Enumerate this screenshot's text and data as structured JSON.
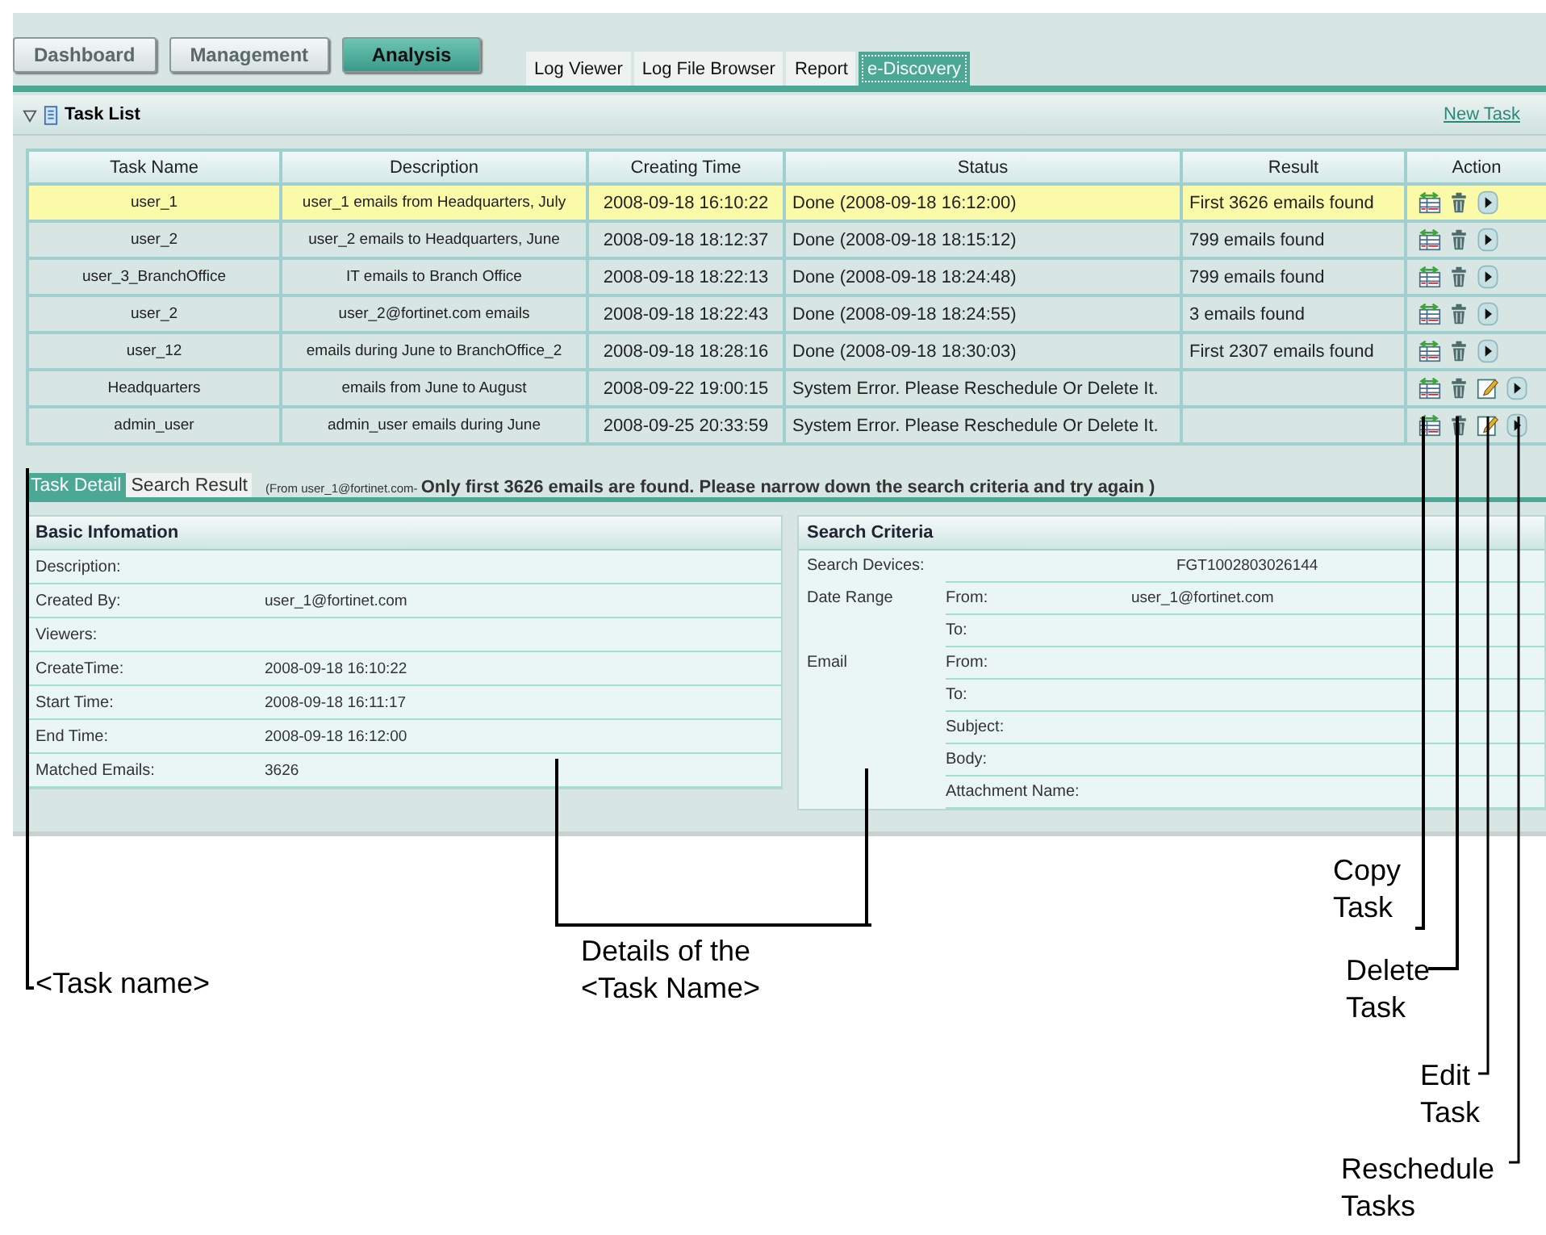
{
  "nav_buttons": [
    {
      "label": "Dashboard",
      "selected": false
    },
    {
      "label": "Management",
      "selected": false
    },
    {
      "label": "Analysis",
      "selected": true
    }
  ],
  "sub_tabs": [
    {
      "label": "Log Viewer",
      "selected": false
    },
    {
      "label": "Log File Browser",
      "selected": false
    },
    {
      "label": "Report",
      "selected": false
    },
    {
      "label": "e-Discovery",
      "selected": true
    }
  ],
  "task_list": {
    "title": "Task List",
    "expanded": true,
    "new_task_link": "New Task",
    "columns": [
      "Task Name",
      "Description",
      "Creating Time",
      "Status",
      "Result",
      "Action"
    ],
    "rows": [
      {
        "task_name": "user_1",
        "description": "user_1 emails from Headquarters, July",
        "creating_time": "2008-09-18 16:10:22",
        "status": "Done (2008-09-18 16:12:00)",
        "result": "First 3626 emails found",
        "actions": [
          {
            "kind": "copy"
          },
          {
            "kind": "delete"
          },
          {
            "kind": "run"
          }
        ],
        "selected": true
      },
      {
        "task_name": "user_2",
        "description": "user_2 emails to Headquarters, June",
        "creating_time": "2008-09-18 18:12:37",
        "status": "Done (2008-09-18 18:15:12)",
        "result": "799 emails found",
        "actions": [
          {
            "kind": "copy"
          },
          {
            "kind": "delete"
          },
          {
            "kind": "run"
          }
        ],
        "selected": false
      },
      {
        "task_name": "user_3_BranchOffice",
        "description": "IT emails to Branch Office",
        "creating_time": "2008-09-18 18:22:13",
        "status": "Done (2008-09-18 18:24:48)",
        "result": "799 emails found",
        "actions": [
          {
            "kind": "copy"
          },
          {
            "kind": "delete"
          },
          {
            "kind": "run"
          }
        ],
        "selected": false
      },
      {
        "task_name": "user_2",
        "description": "user_2@fortinet.com emails",
        "creating_time": "2008-09-18 18:22:43",
        "status": "Done (2008-09-18 18:24:55)",
        "result": "3 emails found",
        "actions": [
          {
            "kind": "copy"
          },
          {
            "kind": "delete"
          },
          {
            "kind": "run"
          }
        ],
        "selected": false
      },
      {
        "task_name": "user_12",
        "description": "emails during June to BranchOffice_2",
        "creating_time": "2008-09-18 18:28:16",
        "status": "Done (2008-09-18 18:30:03)",
        "result": "First 2307 emails found",
        "actions": [
          {
            "kind": "copy"
          },
          {
            "kind": "delete"
          },
          {
            "kind": "run"
          }
        ],
        "selected": false
      },
      {
        "task_name": "Headquarters",
        "description": "emails from June to August",
        "creating_time": "2008-09-22 19:00:15",
        "status": "System Error. Please Reschedule Or Delete It.",
        "actions": [
          {
            "kind": "copy"
          },
          {
            "kind": "delete"
          },
          {
            "kind": "edit"
          },
          {
            "kind": "run"
          }
        ],
        "selected": false
      },
      {
        "task_name": "admin_user",
        "description": "admin_user emails during June",
        "creating_time": "2008-09-25 20:33:59",
        "status": "System Error. Please Reschedule Or Delete It.",
        "actions": [
          {
            "kind": "copy"
          },
          {
            "kind": "delete"
          },
          {
            "kind": "edit"
          },
          {
            "kind": "run"
          }
        ],
        "selected": false
      }
    ]
  },
  "detail_tabs": [
    {
      "label": "Task Detail",
      "selected": true
    },
    {
      "label": "Search Result",
      "selected": false
    }
  ],
  "detail_message": "(From user_1@fortinet.com- **Only first 3626 emails are found. Please narrow down the search criteria and try again )**",
  "basic_information": {
    "title": "Basic Infomation",
    "rows": [
      {
        "label": "Description:"
      },
      {
        "label": "Created By:",
        "value": "user_1@fortinet.com"
      },
      {
        "label": "Viewers:"
      },
      {
        "label": "CreateTime:",
        "value": "2008-09-18 16:10:22"
      },
      {
        "label": "Start Time:",
        "value": "2008-09-18 16:11:17"
      },
      {
        "label": "End Time:",
        "value": "2008-09-18 16:12:00"
      },
      {
        "label": "Matched Emails:",
        "value": "3626"
      }
    ]
  },
  "search_criteria": {
    "title": "Search Criteria",
    "rows": [
      {
        "label": "Search Devices:",
        "value": "FGT1002803026144"
      },
      {
        "label": "Date Range",
        "sublabel": "From:",
        "value": "user_1@fortinet.com"
      },
      {
        "sublabel": "To:"
      },
      {
        "label": "Email",
        "sublabel": "From:"
      },
      {
        "sublabel": "To:"
      },
      {
        "sublabel": "Subject:"
      },
      {
        "sublabel": "Body:"
      },
      {
        "sublabel": "Attachment Name:"
      }
    ]
  },
  "annotations": [
    {
      "lines": [
        "<Task name>"
      ]
    },
    {
      "lines": [
        "Details of the",
        "<Task Name>"
      ]
    },
    {
      "lines": [
        "Copy",
        "Task"
      ]
    },
    {
      "lines": [
        "Delete",
        "Task"
      ]
    },
    {
      "lines": [
        "Edit",
        "Task"
      ]
    },
    {
      "lines": [
        "Reschedule",
        "Tasks"
      ]
    }
  ]
}
